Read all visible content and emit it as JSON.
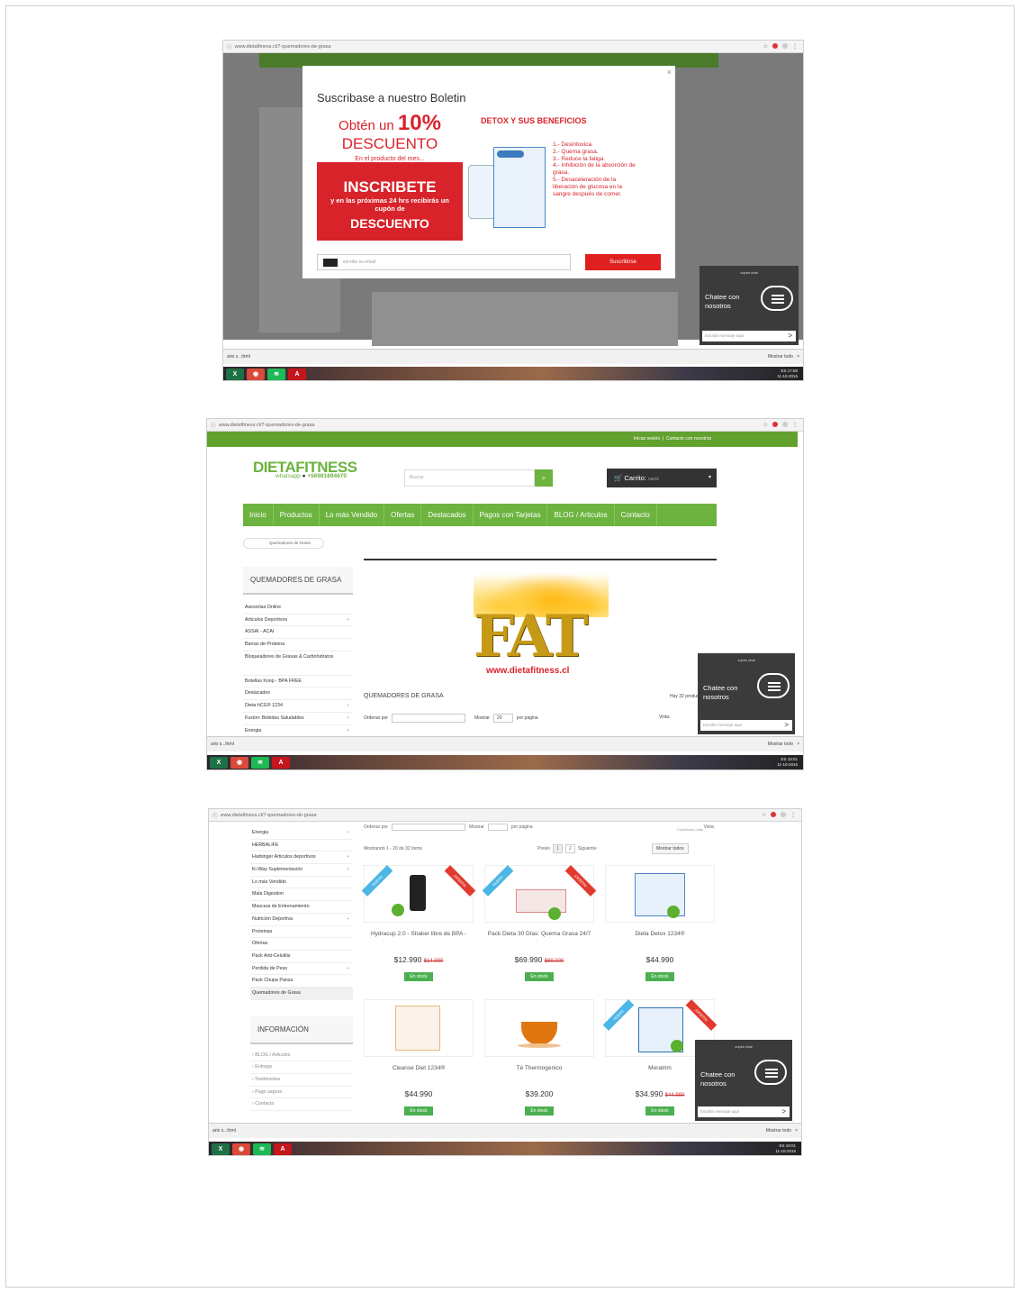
{
  "browser": {
    "url_s1": "www.dietafitness.cl/7-quemadores-de-grasa",
    "url_s2": "www.dietafitness.cl/7-quemadores-de-grasa",
    "url_s3": "www.dietafitness.cl/7-quemadores-de-grasa"
  },
  "popup": {
    "title": "Suscribase a nuestro Boletin",
    "close": "×",
    "ad_line1": "Obtén un",
    "ad_pct": "10%",
    "ad_desc": "DESCUENTO",
    "ad_sub": "En el producto del mes...",
    "ad_inscribe": "INSCRIBETE",
    "ad_small": "y en las próximas 24 hrs recibirás un cupón de",
    "ad_bottom": "DESCUENTO",
    "detox_title": "DETOX Y SUS BENEFICIOS",
    "benefits": [
      "1.- Desintoxica.",
      "2.- Quema grasa.",
      "3.- Reduce la fatiga.",
      "4.- Inhibición de la absorción de grasa.",
      "5.- Desaceleración de la liberación de glucosa en la sangre después de comer."
    ],
    "email_placeholder": "escribe su email",
    "subscribe": "Suscribirse"
  },
  "site": {
    "top_links": [
      "Iniciar sesión",
      "Contacte con nosotros"
    ],
    "logo": "DIETAFITNESS",
    "whatsapp": "whatsapp",
    "phone": "+56981894670",
    "search_placeholder": "Buscar",
    "search_icon": "search-icon",
    "cart_label": "Carrito:",
    "cart_value": "vacío",
    "nav": [
      "Inicio",
      "Productos",
      "Lo más Vendido",
      "Ofertas",
      "Destacados",
      "Pagos con Tarjetas",
      "BLOG / Articulos",
      "Contacto"
    ],
    "breadcrumb": "Quemadores de Grasa",
    "category_title": "QUEMADORES DE GRASA",
    "banner_text": "FAT",
    "banner_url": "www.dietafitness.cl",
    "hay": "Hay 32 productos.",
    "ordenar": "Ordenar por",
    "mostrar": "Mostrar",
    "mostrar_val": "20",
    "per_page": "por página",
    "vista": "Vista:"
  },
  "sidebar": {
    "title": "QUEMADORES DE GRASA",
    "items": [
      "Asesorias Online",
      "Articulos Deportivos",
      "ASSAI - ACAI",
      "Barras de Proteina",
      "Bloqueadores de Grasas & Carbohidratos",
      "Botellas Koop - BPA FREE",
      "Destacados",
      "Dieta hCG® 1234",
      "Fuxion: Bebidas Saludables",
      "Energia"
    ],
    "items3": [
      "Energia",
      "HERBALIFE",
      "Harbinger Articulos deportivos",
      "Ki-Way Suplementación",
      "Lo más Vendido",
      "Mala Digestion",
      "Mascara de Entrenamiento",
      "Nutrición Deportiva",
      "Proteinas",
      "Ofertas",
      "Pack Anti-Celulitis",
      "Perdida de Peso",
      "Pack Chupa Panza",
      "Quemadores de Grasa"
    ],
    "info_title": "INFORMACIÓN",
    "info": [
      "BLOG / Articulos",
      "Entrega",
      "Testimonios",
      "Pago seguro",
      "Contacto"
    ]
  },
  "listing": {
    "showing": "Mostrando 1 - 20 de 32 items",
    "prev": "Previo",
    "pages": [
      "1",
      "2"
    ],
    "next": "Siguiente",
    "show_all": "Mostrar todos",
    "grid_list": "Cuadrícula  Lista"
  },
  "products": [
    {
      "name": "Hydracup 2.0 - Shaker libre de BPA -",
      "price": "$12.990",
      "old": "$14.990",
      "stock": "En stock",
      "nuevo": "NUEVO",
      "oferta": "¡OFERTA!"
    },
    {
      "name": "Pack Dieta 30 Días: Quema Grasa 24/7",
      "price": "$69.990",
      "old": "$89.000",
      "stock": "En stock",
      "nuevo": "NUEVO",
      "oferta": "¡OFERTA!"
    },
    {
      "name": "Dieta Detox 1234®",
      "price": "$44.990",
      "old": "",
      "stock": "En stock",
      "nuevo": "",
      "oferta": ""
    },
    {
      "name": "Cleanse Diet 1234®",
      "price": "$44.990",
      "old": "",
      "stock": "En stock",
      "nuevo": "",
      "oferta": ""
    },
    {
      "name": "Té Thermogenico",
      "price": "$39.200",
      "old": "",
      "stock": "En stock",
      "nuevo": "",
      "oferta": ""
    },
    {
      "name": "Meratrim",
      "price": "$34.990",
      "old": "$44.990",
      "stock": "En stock",
      "nuevo": "NUEVO",
      "oferta": "¡OFERTA!"
    }
  ],
  "chat": {
    "brand": "zopim chat",
    "text1": "Chatee con",
    "text2": "nosotros",
    "placeholder": "Escribir mensaje aquí",
    "send": ">"
  },
  "downloads": {
    "file": "ario s...html",
    "show_all": "Mostrar todo",
    "close": "×"
  },
  "taskbar": {
    "lang": "ES",
    "time1": "17:58",
    "date1": "11-10-2016",
    "time2": "18:01",
    "date2": "11-10-2016",
    "time3": "18:01",
    "date3": "11-10-2016"
  },
  "colors": {
    "green": "#6cb33f",
    "red": "#e02020",
    "dark": "#333333"
  }
}
